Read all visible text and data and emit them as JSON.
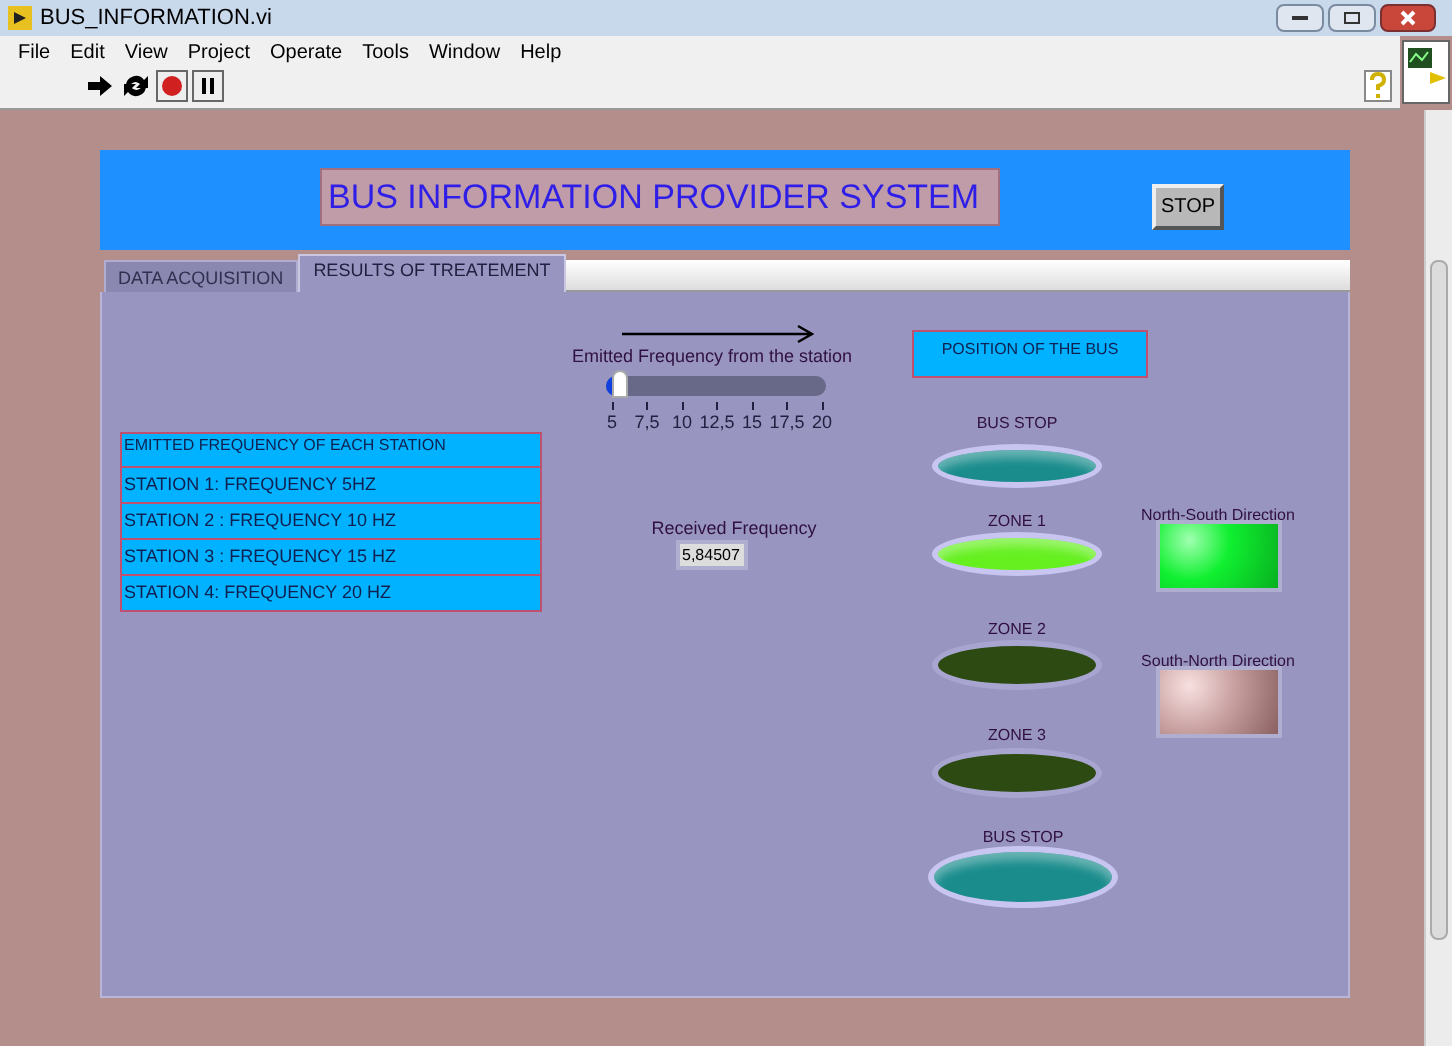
{
  "window": {
    "title": "BUS_INFORMATION.vi"
  },
  "menu": [
    "File",
    "Edit",
    "View",
    "Project",
    "Operate",
    "Tools",
    "Window",
    "Help"
  ],
  "header": {
    "title": "BUS INFORMATION PROVIDER SYSTEM",
    "stop_button": "STOP"
  },
  "tabs": [
    {
      "label": "DATA ACQUISITION",
      "selected": false
    },
    {
      "label": "RESULTS OF TREATEMENT",
      "selected": true
    }
  ],
  "station_list": {
    "heading": "EMITTED FREQUENCY  OF EACH STATION",
    "items": [
      "STATION 1: FREQUENCY 5HZ",
      "STATION  2 : FREQUENCY 10 HZ",
      "STATION 3 : FREQUENCY 15 HZ",
      "STATION 4:  FREQUENCY 20 HZ"
    ]
  },
  "slider": {
    "label": "Emitted Frequency from the station",
    "level": 0.056,
    "ticks": [
      "5",
      "7,5",
      "10",
      "12,5",
      "15",
      "17,5",
      "20"
    ]
  },
  "received": {
    "label": "Received Frequency",
    "value": "5,84507"
  },
  "position": {
    "title": "POSITION OF THE BUS",
    "leds": [
      {
        "label": "BUS STOP",
        "on": true,
        "color": "#1a8c8c"
      },
      {
        "label": "ZONE 1",
        "on": true,
        "color": "#66f020"
      },
      {
        "label": "ZONE 2",
        "on": false,
        "color": "#2d4a12"
      },
      {
        "label": "ZONE 3",
        "on": false,
        "color": "#2d4a12"
      },
      {
        "label": "BUS STOP",
        "on": true,
        "color": "#1a8c8c"
      }
    ]
  },
  "directions": [
    {
      "label": "North-South  Direction",
      "on": true
    },
    {
      "label": "South-North Direction",
      "on": false
    }
  ]
}
